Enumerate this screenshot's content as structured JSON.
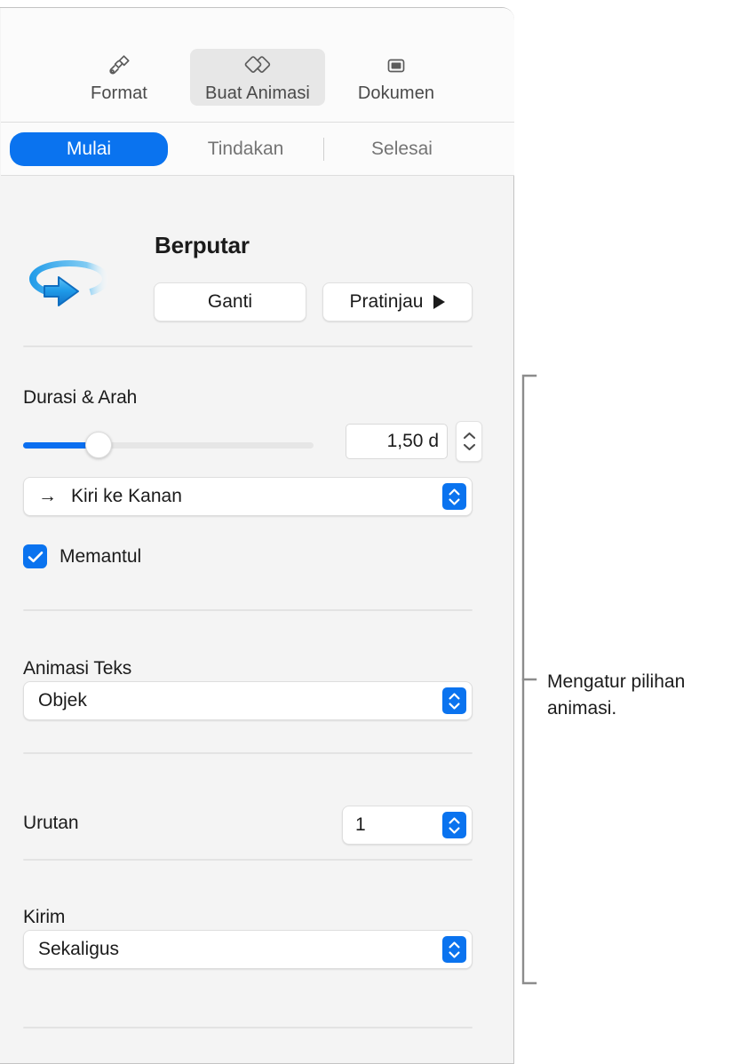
{
  "inspector": {
    "toolbar": {
      "items": [
        {
          "label": "Format",
          "icon": "paintbrush-icon",
          "active": false
        },
        {
          "label": "Buat Animasi",
          "icon": "animate-diamonds-icon",
          "active": true
        },
        {
          "label": "Dokumen",
          "icon": "document-slide-icon",
          "active": false
        }
      ]
    },
    "tabs": {
      "items": [
        {
          "label": "Mulai",
          "selected": true
        },
        {
          "label": "Tindakan",
          "selected": false
        },
        {
          "label": "Selesai",
          "selected": false
        }
      ]
    },
    "effect": {
      "name": "Berputar",
      "icon": "rotate-arrow-icon",
      "change_label": "Ganti",
      "preview_label": "Pratinjau",
      "preview_icon": "play-triangle-icon"
    },
    "duration": {
      "section_title": "Durasi & Arah",
      "slider_value_percent": 26,
      "field_value": "1,50 d",
      "stepper_icon": "stepper-up-down-icon"
    },
    "direction": {
      "arrow_glyph": "→",
      "value": "Kiri ke Kanan",
      "popup_icon": "popup-chevrons-icon"
    },
    "bounce": {
      "label": "Memantul",
      "checked": true,
      "check_icon": "checkmark-icon"
    },
    "text_animation": {
      "section_title": "Animasi Teks",
      "value": "Objek",
      "popup_icon": "popup-chevrons-icon"
    },
    "order": {
      "section_title": "Urutan",
      "value": "1",
      "popup_icon": "popup-chevrons-icon"
    },
    "delivery": {
      "section_title": "Kirim",
      "value": "Sekaligus",
      "popup_icon": "popup-chevrons-icon"
    }
  },
  "callout": {
    "text": "Mengatur pilihan animasi.",
    "bracket_icon": "callout-bracket-icon"
  },
  "colors": {
    "accent_blue": "#0a73ef",
    "slider_blue": "#0a6ff0",
    "panel_bg": "#f4f4f4",
    "toolbar_bg": "#fbfbfb",
    "text_primary": "#1b1b1b",
    "text_secondary": "#747474",
    "separator": "#e3e3e3"
  }
}
